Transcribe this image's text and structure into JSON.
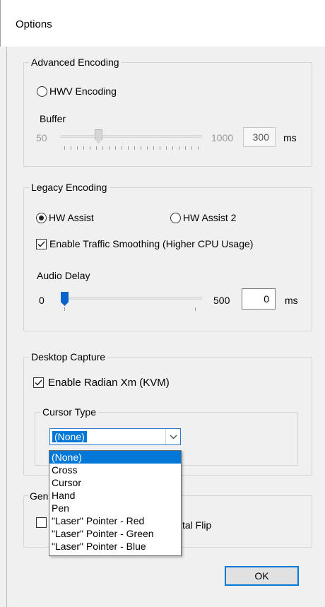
{
  "window": {
    "title": "Options"
  },
  "advanced": {
    "legend": "Advanced Encoding",
    "hwv_label": "HWV Encoding",
    "buffer_label": "Buffer",
    "min": "50",
    "max": "1000",
    "value": "300",
    "unit": "ms"
  },
  "legacy": {
    "legend": "Legacy Encoding",
    "hw_assist": "HW Assist",
    "hw_assist2": "HW Assist 2",
    "smoothing": "Enable Traffic Smoothing (Higher CPU Usage)",
    "audio_label": "Audio Delay",
    "min": "0",
    "max": "500",
    "value": "0",
    "unit": "ms"
  },
  "desktop": {
    "legend": "Desktop Capture",
    "enable_label": "Enable Radian Xm (KVM)",
    "cursor_legend": "Cursor Type",
    "cursor_selected": "(None)",
    "cursor_options": [
      "(None)",
      "Cross",
      "Cursor",
      "Hand",
      "Pen",
      "\"Laser\" Pointer - Red",
      "\"Laser\" Pointer - Green",
      "\"Laser\" Pointer - Blue"
    ]
  },
  "general": {
    "legend_partial": "Gen",
    "flip_partial": "tal Flip"
  },
  "buttons": {
    "ok": "OK"
  },
  "colors": {
    "accent": "#0078d7",
    "slider_thumb": "#0a63c8"
  }
}
